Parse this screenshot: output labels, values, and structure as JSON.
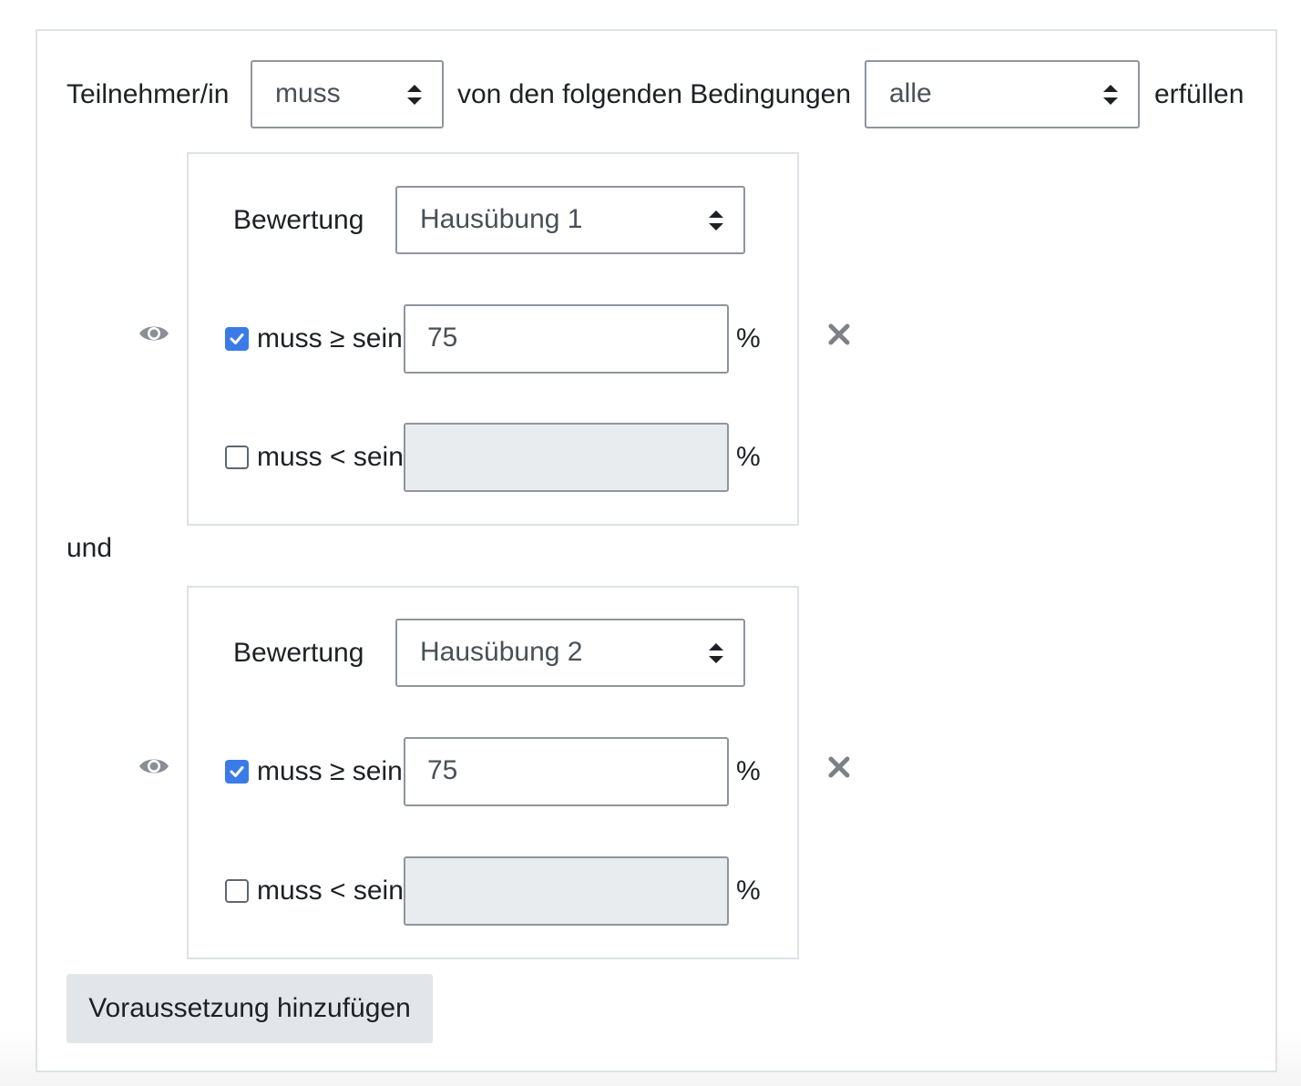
{
  "header": {
    "label_prefix": "Teilnehmer/in",
    "must_select": "muss",
    "label_middle": "von den folgenden Bedingungen",
    "scope_select": "alle",
    "label_suffix": "erfüllen"
  },
  "connector": "und",
  "conditions": [
    {
      "type_label": "Bewertung",
      "grade_item": "Hausübung 1",
      "min": {
        "checked": true,
        "label": "muss ≥ sein",
        "value": "75",
        "unit": "%"
      },
      "max": {
        "checked": false,
        "label": "muss < sein",
        "value": "",
        "unit": "%"
      },
      "icons": {
        "visibility": "eye-icon",
        "delete": "close-icon"
      }
    },
    {
      "type_label": "Bewertung",
      "grade_item": "Hausübung 2",
      "min": {
        "checked": true,
        "label": "muss ≥ sein",
        "value": "75",
        "unit": "%"
      },
      "max": {
        "checked": false,
        "label": "muss < sein",
        "value": "",
        "unit": "%"
      },
      "icons": {
        "visibility": "eye-icon",
        "delete": "close-icon"
      }
    }
  ],
  "add_button": "Voraussetzung hinzufügen",
  "colors": {
    "checkbox_checked": "#3b7be8",
    "border": "#8f959e",
    "disabled_input": "#e9ecef",
    "button_bg": "#e2e5e9"
  }
}
